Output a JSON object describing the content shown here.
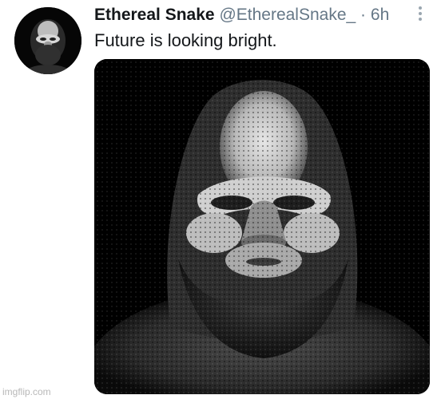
{
  "tweet": {
    "display_name": "Ethereal Snake",
    "handle": "@EtherealSnake_",
    "separator": "·",
    "time": "6h",
    "text": "Future is looking bright.",
    "avatar_icon": "bigfoot-portrait",
    "media_icon": "bigfoot-portrait-photo",
    "more_icon": "vertical-ellipsis-icon"
  },
  "watermark": {
    "text": "imgflip.com"
  },
  "colors": {
    "name": "#14171a",
    "secondary": "#657786",
    "more_dots": "#9aa6b0",
    "media_bg": "#000000",
    "watermark": "#b8b8b8"
  }
}
